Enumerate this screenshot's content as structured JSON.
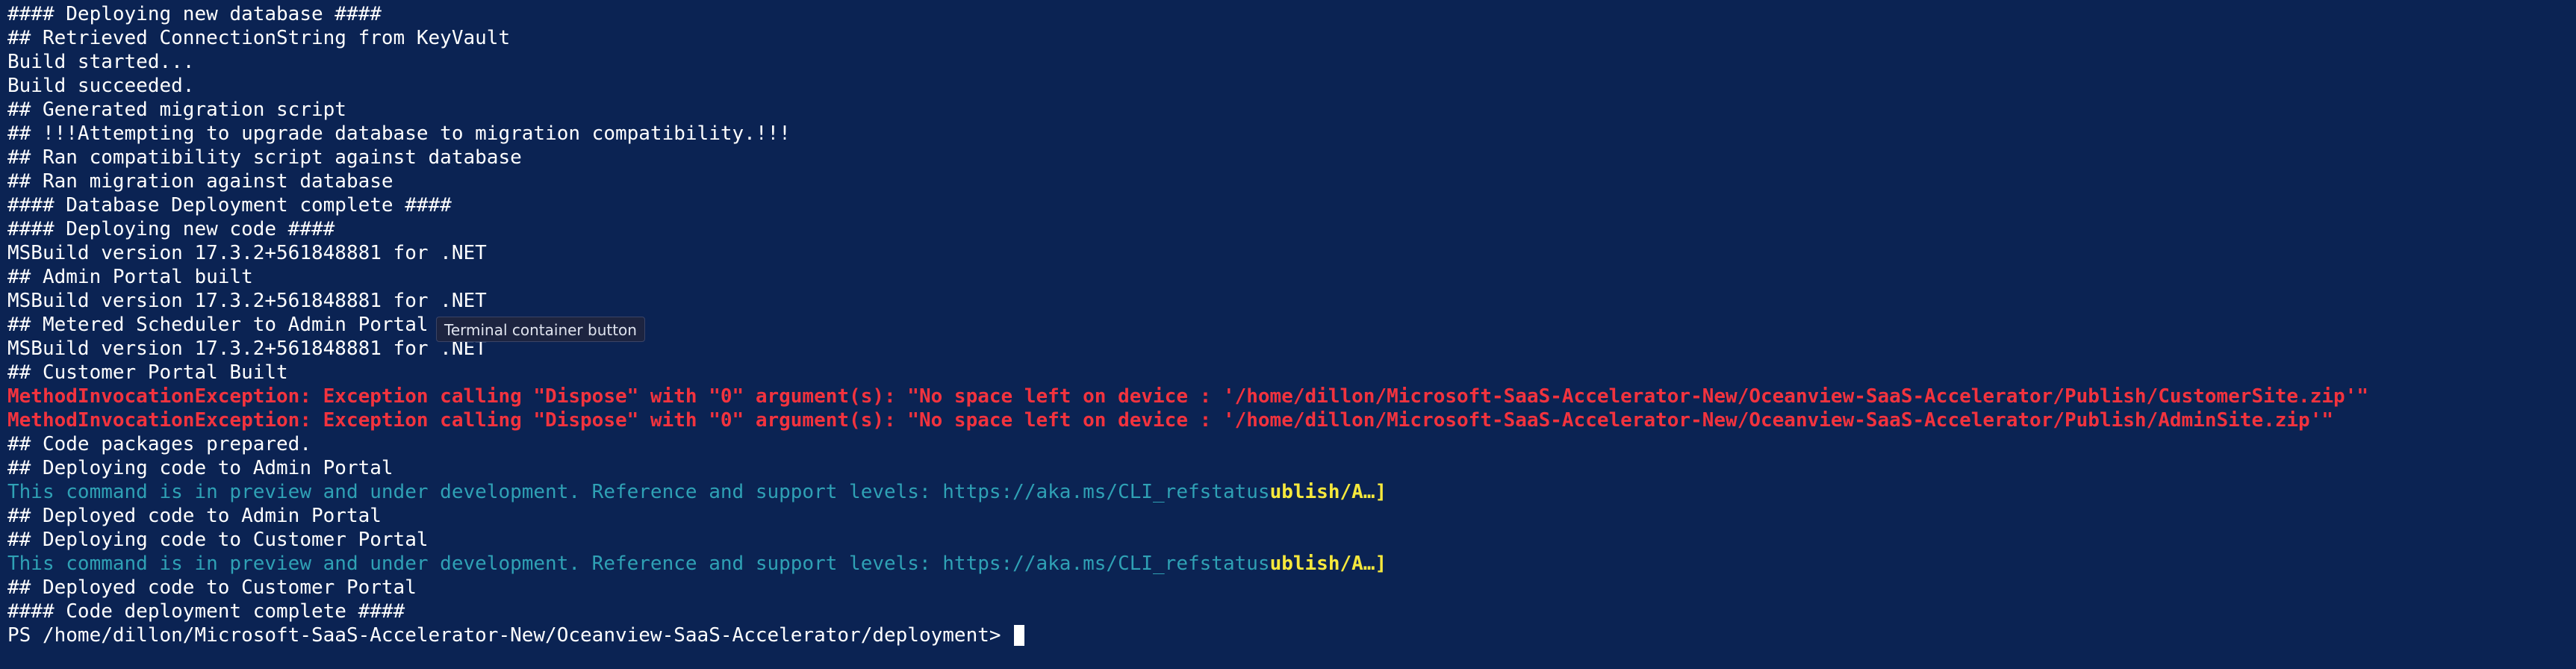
{
  "terminal": {
    "lines": [
      {
        "type": "white",
        "text": "#### Deploying new database ####"
      },
      {
        "type": "white",
        "text": "## Retrieved ConnectionString from KeyVault"
      },
      {
        "type": "white",
        "text": "Build started..."
      },
      {
        "type": "white",
        "text": "Build succeeded."
      },
      {
        "type": "white",
        "text": "## Generated migration script"
      },
      {
        "type": "white",
        "text": "## !!!Attempting to upgrade database to migration compatibility.!!!"
      },
      {
        "type": "white",
        "text": "## Ran compatibility script against database"
      },
      {
        "type": "white",
        "text": "## Ran migration against database"
      },
      {
        "type": "white",
        "text": "#### Database Deployment complete ####"
      },
      {
        "type": "white",
        "text": "#### Deploying new code ####"
      },
      {
        "type": "white",
        "text": "MSBuild version 17.3.2+561848881 for .NET"
      },
      {
        "type": "white",
        "text": "## Admin Portal built"
      },
      {
        "type": "white",
        "text": "MSBuild version 17.3.2+561848881 for .NET"
      },
      {
        "type": "white",
        "text": "## Metered Scheduler to Admin Portal B"
      },
      {
        "type": "white",
        "text": "MSBuild version 17.3.2+561848881 for .NET"
      },
      {
        "type": "white",
        "text": "## Customer Portal Built"
      },
      {
        "type": "error",
        "text": "MethodInvocationException: Exception calling \"Dispose\" with \"0\" argument(s): \"No space left on device : '/home/dillon/Microsoft-SaaS-Accelerator-New/Oceanview-SaaS-Accelerator/Publish/CustomerSite.zip'\""
      },
      {
        "type": "error",
        "text": "MethodInvocationException: Exception calling \"Dispose\" with \"0\" argument(s): \"No space left on device : '/home/dillon/Microsoft-SaaS-Accelerator-New/Oceanview-SaaS-Accelerator/Publish/AdminSite.zip'\""
      },
      {
        "type": "white",
        "text": "## Code packages prepared."
      },
      {
        "type": "white",
        "text": "## Deploying code to Admin Portal"
      },
      {
        "type": "info",
        "text": "This command is in preview and under development. Reference and support levels: https://aka.ms/CLI_refstatus",
        "highlight": "ublish/A…]"
      },
      {
        "type": "white",
        "text": "## Deployed code to Admin Portal"
      },
      {
        "type": "white",
        "text": "## Deploying code to Customer Portal"
      },
      {
        "type": "info",
        "text": "This command is in preview and under development. Reference and support levels: https://aka.ms/CLI_refstatus",
        "highlight": "ublish/A…]"
      },
      {
        "type": "white",
        "text": "## Deployed code to Customer Portal"
      },
      {
        "type": "white",
        "text": "#### Code deployment complete ####"
      }
    ],
    "prompt": "PS /home/dillon/Microsoft-SaaS-Accelerator-New/Oceanview-SaaS-Accelerator/deployment> "
  },
  "tooltip": {
    "text": "Terminal container button"
  },
  "colors": {
    "background": "#0b2353",
    "text": "#ffffff",
    "error": "#f2333e",
    "info": "#2fa1b5",
    "highlight": "#f6e83c"
  }
}
